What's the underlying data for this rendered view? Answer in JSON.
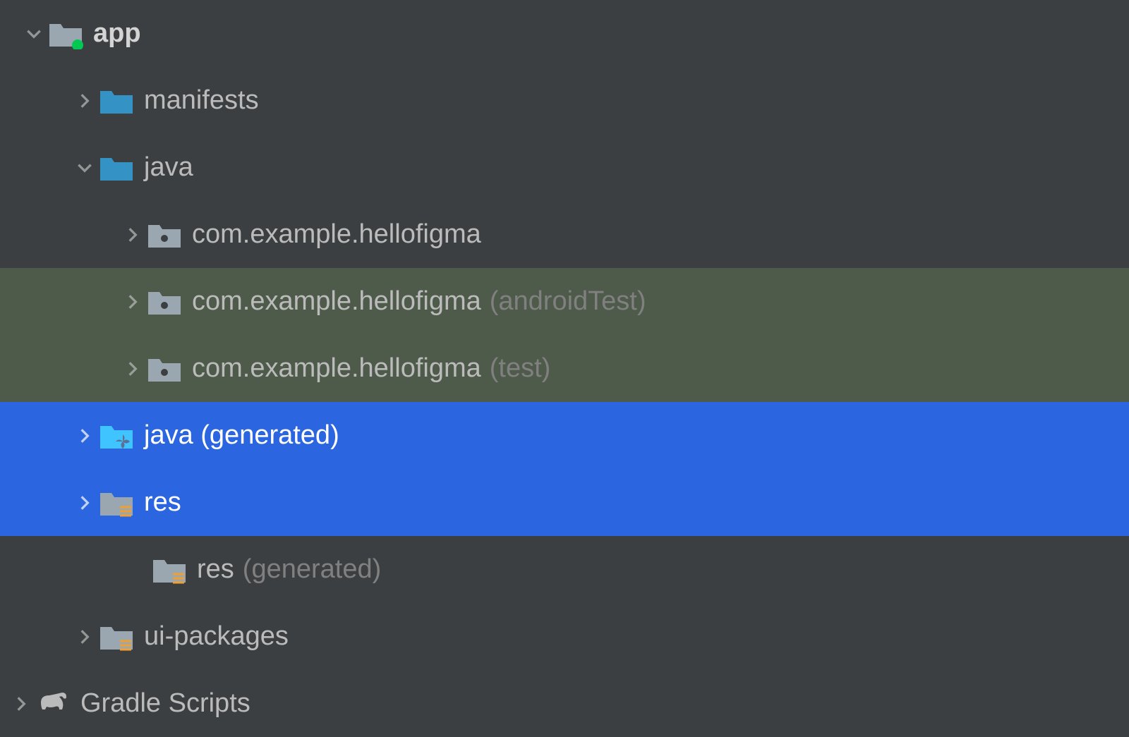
{
  "tree": {
    "app": {
      "label": "app"
    },
    "manifests": {
      "label": "manifests"
    },
    "java": {
      "label": "java"
    },
    "package_main": {
      "label": "com.example.hellofigma"
    },
    "package_android_test": {
      "label": "com.example.hellofigma",
      "suffix": "(androidTest)"
    },
    "package_test": {
      "label": "com.example.hellofigma",
      "suffix": "(test)"
    },
    "java_generated": {
      "label": "java (generated)"
    },
    "res": {
      "label": "res"
    },
    "res_generated": {
      "label": "res",
      "suffix": "(generated)"
    },
    "ui_packages": {
      "label": "ui-packages"
    },
    "gradle": {
      "label": "Gradle Scripts"
    }
  }
}
